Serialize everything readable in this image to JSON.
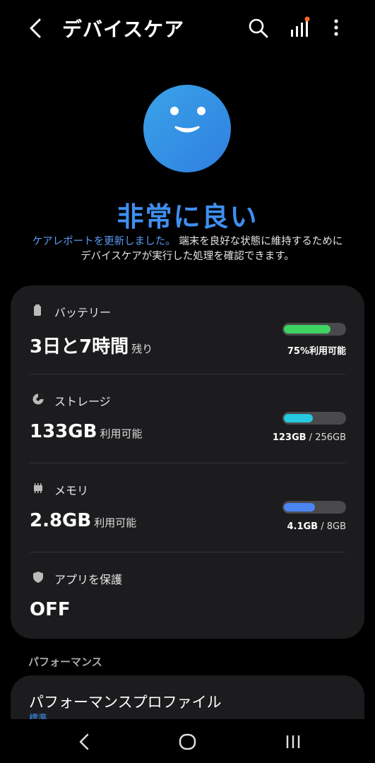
{
  "header": {
    "title": "デバイスケア"
  },
  "status": {
    "label": "非常に良い",
    "desc_link": "ケアレポートを更新しました。",
    "desc_rest": " 端末を良好な状態に維持するためにデバイスケアが実行した処理を確認できます。"
  },
  "items": {
    "battery": {
      "label": "バッテリー",
      "value": "3日と7時間",
      "unit": "残り",
      "caption": "75%利用可能",
      "level": 0.75,
      "color": "#3ed463"
    },
    "storage": {
      "label": "ストレージ",
      "value": "133GB",
      "unit": "利用可能",
      "caption_used": "123GB",
      "caption_total": " / 256GB",
      "level": 0.48,
      "color": "#25c9e0"
    },
    "memory": {
      "label": "メモリ",
      "value": "2.8GB",
      "unit": "利用可能",
      "caption_used": "4.1GB",
      "caption_total": " / 8GB",
      "level": 0.51,
      "color": "#4a85f2"
    },
    "app_protect": {
      "label": "アプリを保護",
      "value": "OFF"
    }
  },
  "performance": {
    "section": "パフォーマンス",
    "title": "パフォーマンスプロファイル",
    "sub": "標準"
  },
  "colors": {
    "accent": "#3f8ff0",
    "card": "#1c1c1e"
  }
}
